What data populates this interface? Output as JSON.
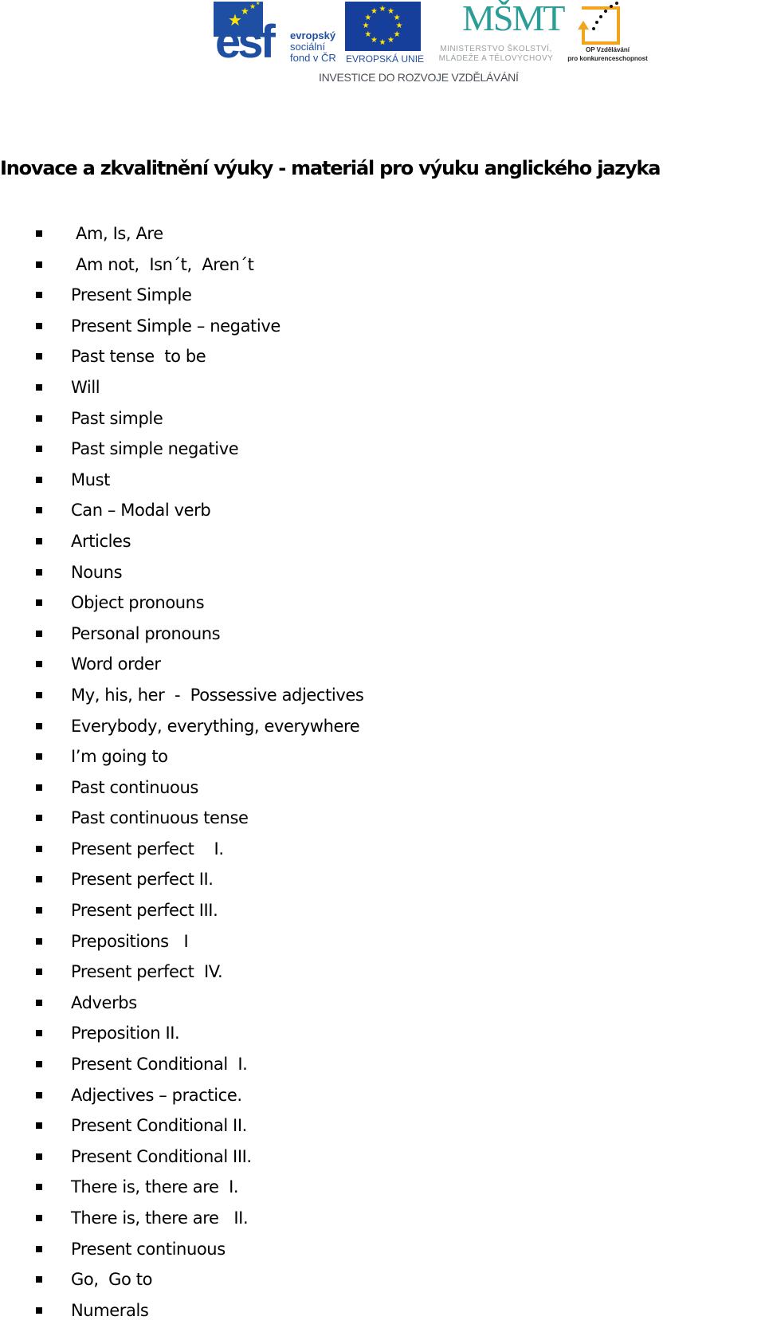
{
  "header": {
    "logos": {
      "esf": {
        "line1": "evropský",
        "line2": "sociální",
        "line3": "fond v ČR",
        "mark": "esf"
      },
      "eu": {
        "label": "EVROPSKÁ UNIE"
      },
      "msmt": {
        "mark": "MŠMT",
        "line1": "MINISTERSTVO ŠKOLSTVÍ,",
        "line2": "MLÁDEŽE A TĚLOVÝCHOVY"
      },
      "op": {
        "line1": "OP Vzdělávání",
        "line2": "pro konkurenceschopnost"
      }
    },
    "tagline": "INVESTICE DO ROZVOJE VZDĚLÁVÁNÍ",
    "colors": {
      "esf_blue": "#1f4fa3",
      "eu_blue": "#163e9b",
      "eu_star": "#ffe600",
      "msmt_teal": "#2a9e96",
      "op_orange": "#f2a41c"
    }
  },
  "document": {
    "title": "Inovace a zkvalitnění výuky - materiál pro výuku anglického jazyka",
    "items": [
      " Am, Is, Are",
      " Am not,  Isn´t,  Aren´t",
      "Present Simple",
      "Present Simple – negative",
      "Past tense  to be",
      "Will",
      "Past simple",
      "Past simple negative",
      "Must",
      "Can – Modal verb",
      "Articles",
      "Nouns",
      "Object pronouns",
      "Personal pronouns",
      "Word order",
      "My, his, her  -  Possessive adjectives",
      "Everybody, everything, everywhere",
      "I’m going to",
      "Past continuous",
      "Past continuous tense",
      "Present perfect    I.",
      "Present perfect II.",
      "Present perfect III.",
      "Prepositions   I",
      "Present perfect  IV.",
      "Adverbs",
      "Preposition II.",
      "Present Conditional  I.",
      "Adjectives – practice.",
      "Present Conditional II.",
      "Present Conditional III.",
      "There is, there are  I.",
      "There is, there are   II.",
      "Present continuous",
      "Go,  Go to",
      "Numerals"
    ]
  }
}
